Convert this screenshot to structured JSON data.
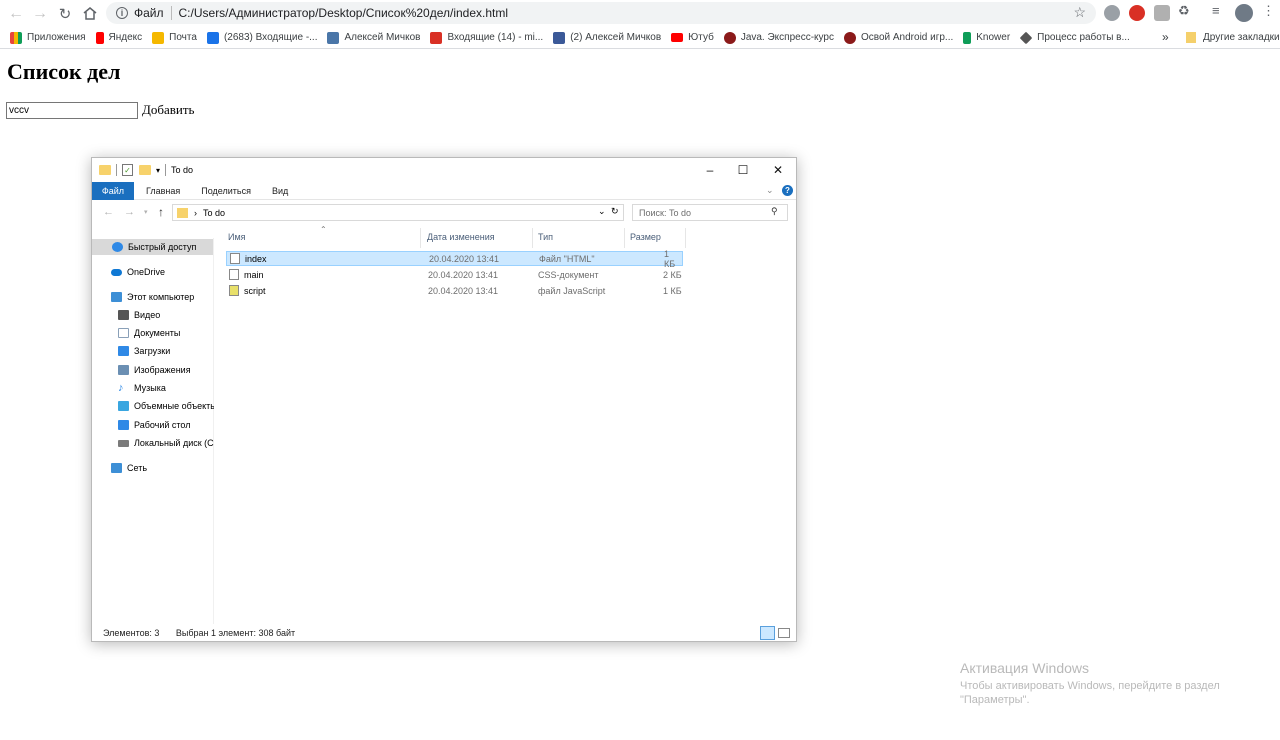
{
  "browser": {
    "url": "C:/Users/Администратор/Desktop/Список%20дел/index.html",
    "url_label": "Файл",
    "bookmarks": [
      {
        "label": "Приложения",
        "color": "#e8453c"
      },
      {
        "label": "Яндекс",
        "color": "#ff0000"
      },
      {
        "label": "Почта",
        "color": "#f5b800"
      },
      {
        "label": "(2683) Входящие -...",
        "color": "#1a73e8"
      },
      {
        "label": "Алексей Мичков",
        "color": "#4a76a8"
      },
      {
        "label": "Входящие (14) - mi...",
        "color": "#d93025"
      },
      {
        "label": "(2) Алексей Мичков",
        "color": "#3b5998"
      },
      {
        "label": "Ютуб",
        "color": "#ff0000"
      },
      {
        "label": "Java. Экспресс-курс",
        "color": "#8b1a1a"
      },
      {
        "label": "Освой Android игр...",
        "color": "#8b1a1a"
      },
      {
        "label": "Knower",
        "color": "#0f9d58"
      },
      {
        "label": "Процесс работы в...",
        "color": "#555555"
      }
    ],
    "more_bookmarks": "»",
    "other_bookmarks": "Другие закладки"
  },
  "page": {
    "title": "Список дел",
    "input_value": "vccv",
    "add_label": "Добавить"
  },
  "explorer": {
    "window_title": "To do",
    "ribbon_tabs": [
      "Файл",
      "Главная",
      "Поделиться",
      "Вид"
    ],
    "address_path": "To do",
    "search_placeholder": "Поиск: To do",
    "nav": [
      {
        "label": "Быстрый доступ",
        "color": "#2f89e6"
      },
      {
        "label": "OneDrive",
        "color": "#0f78d4"
      },
      {
        "label": "Этот компьютер",
        "color": "#3d8fd6"
      },
      {
        "label": "Видео",
        "color": "#555555"
      },
      {
        "label": "Документы",
        "color": "#8aa0b8"
      },
      {
        "label": "Загрузки",
        "color": "#2f89e6"
      },
      {
        "label": "Изображения",
        "color": "#6b8fb3"
      },
      {
        "label": "Музыка",
        "color": "#2f89e6"
      },
      {
        "label": "Объемные объекты",
        "color": "#39a6e0"
      },
      {
        "label": "Рабочий стол",
        "color": "#2f89e6"
      },
      {
        "label": "Локальный диск (C",
        "color": "#7a7a7a"
      },
      {
        "label": "Сеть",
        "color": "#3d8fd6"
      }
    ],
    "columns": [
      "Имя",
      "Дата изменения",
      "Тип",
      "Размер"
    ],
    "files": [
      {
        "name": "index",
        "date": "20.04.2020 13:41",
        "type": "Файл \"HTML\"",
        "size": "1 КБ"
      },
      {
        "name": "main",
        "date": "20.04.2020 13:41",
        "type": "CSS-документ",
        "size": "2 КБ"
      },
      {
        "name": "script",
        "date": "20.04.2020 13:41",
        "type": "файл JavaScript",
        "size": "1 КБ"
      }
    ],
    "status_count": "Элементов: 3",
    "status_selected": "Выбран 1 элемент: 308 байт"
  },
  "watermark": {
    "title": "Активация Windows",
    "line1": "Чтобы активировать Windows, перейдите в раздел",
    "line2": "\"Параметры\"."
  }
}
